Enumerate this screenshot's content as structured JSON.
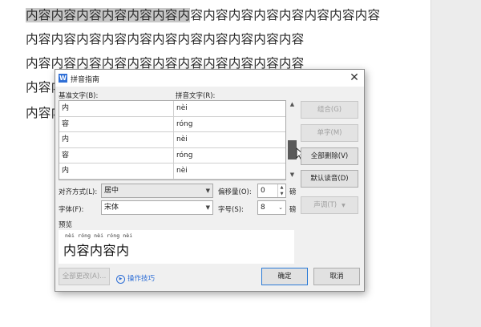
{
  "document": {
    "lines": [
      "内容内容内容内容内容内容内容内容内容内容内容",
      "内容内容内容内容内容内容内容内容内容内容内容",
      "内容内容内容内容内容内容内容内容内容内容内容",
      "内容内",
      "内容内"
    ],
    "selected_text": "内容内容内容内容内容内容内",
    "line1_rest": "容内容内容内容内容内容内容内容"
  },
  "dialog": {
    "title": "拼音指南",
    "close_glyph": "✕",
    "base_header": "基准文字(B):",
    "ruby_header": "拼音文字(R):",
    "rows": [
      {
        "base": "内",
        "ruby": "nèi"
      },
      {
        "base": "容",
        "ruby": "róng"
      },
      {
        "base": "内",
        "ruby": "nèi"
      },
      {
        "base": "容",
        "ruby": "róng"
      },
      {
        "base": "内",
        "ruby": "nèi"
      }
    ],
    "buttons": {
      "combine": "组合(G)",
      "single": "单字(M)",
      "clear_all": "全部删除(V)",
      "default": "默认读音(D)",
      "tone": "声调(T)",
      "apply_all": "全部更改(A)...",
      "ok": "确定",
      "cancel": "取消"
    },
    "align_label": "对齐方式(L):",
    "align_value": "居中",
    "offset_label": "偏移量(O):",
    "offset_value": "0",
    "offset_unit": "磅",
    "font_label": "字体(F):",
    "font_value": "宋体",
    "size_label": "字号(S):",
    "size_value": "8",
    "size_unit": "磅",
    "preview_label": "预览",
    "preview_ruby": "nèi róng nèi róng nèi",
    "preview_text": "内容内容内",
    "tips_link": "操作技巧"
  },
  "colors": {
    "selection": "#c7c7c7",
    "link": "#2f6fd6",
    "primary_border": "#2a7ad6"
  }
}
